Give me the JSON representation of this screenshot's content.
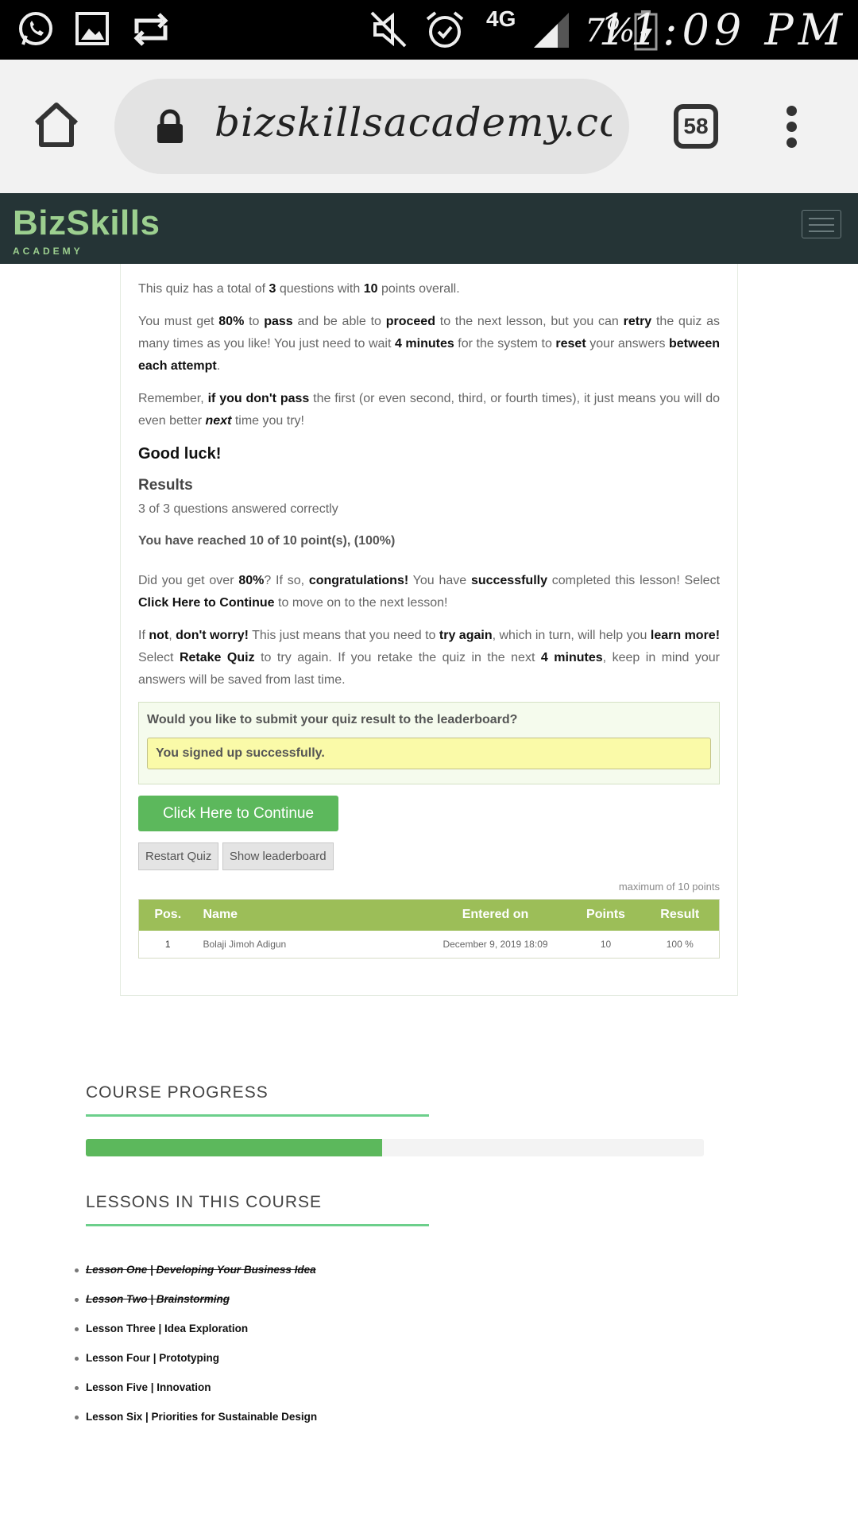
{
  "status_bar": {
    "time": "11:09 PM",
    "battery": "7%",
    "network": "4G",
    "icons": [
      "whatsapp-icon",
      "gallery-icon",
      "sync-icon",
      "mute-icon",
      "alarm-icon",
      "signal-icon",
      "battery-charging-icon"
    ]
  },
  "browser": {
    "url": "bizskillsacademy.com/c",
    "tab_count": "58"
  },
  "site": {
    "logo_main": "BizSkills",
    "logo_sub": "ACADEMY"
  },
  "quiz": {
    "intro": {
      "prefix": "This quiz has a total of ",
      "questions": "3",
      "mid": " questions with ",
      "points": "10",
      "suffix": " points overall."
    },
    "rules": {
      "t1": "You must get ",
      "b1": "80%",
      "t2": " to ",
      "b2": "pass",
      "t3": " and be able to ",
      "b3": "proceed",
      "t4": " to the next lesson, but you can ",
      "b4": "retry",
      "t5": " the quiz as many times as you like! You just need to wait ",
      "b5": "4 minutes",
      "t6": " for the system to ",
      "b6": "reset",
      "t7": " your answers ",
      "b7": "between each attempt",
      "t8": "."
    },
    "remember": {
      "t1": "Remember, ",
      "b1": "if you don't pass",
      "t2": " the first (or even second, third, or fourth times), it just means you will do even better ",
      "b2": "next",
      "t3": " time you try!"
    },
    "good_luck": "Good luck!",
    "results_heading": "Results",
    "results_summary": "3 of 3 questions answered correctly",
    "reached": "You have reached 10 of 10 point(s), (100%)",
    "over": {
      "t1": "Did you get over ",
      "b1": "80%",
      "t2": "? If so, ",
      "b2": "congratulations!",
      "t3": " You have ",
      "b3": "successfully",
      "t4": " completed this lesson! Select ",
      "b4": "Click Here to Continue",
      "t5": " to move on to the next lesson!"
    },
    "not": {
      "t1": "If ",
      "b1": "not",
      "t2": ", ",
      "b2": "don't worry!",
      "t3": " This just means that you need to ",
      "b3": "try again",
      "t4": ", which in turn, will help you ",
      "b4": "learn more!",
      "t5": " Select ",
      "b5": "Retake Quiz",
      "t6": " to try again. If you retake the quiz in the next ",
      "b6": "4 minutes",
      "t7": ", keep in mind your answers will be saved from last time."
    },
    "leaderboard_question": "Would you like to submit your quiz result to the leaderboard?",
    "signup_message": "You signed up successfully.",
    "continue_label": "Click Here to Continue",
    "restart_label": "Restart Quiz",
    "show_leaderboard_label": "Show leaderboard",
    "max_points": "maximum of 10 points",
    "table": {
      "headers": [
        "Pos.",
        "Name",
        "Entered on",
        "Points",
        "Result"
      ],
      "rows": [
        [
          "1",
          "Bolaji Jimoh Adigun",
          "December 9, 2019 18:09",
          "10",
          "100 %"
        ]
      ]
    }
  },
  "course_progress": {
    "heading": "COURSE PROGRESS",
    "percent": 48
  },
  "lessons": {
    "heading": "LESSONS IN THIS COURSE",
    "items": [
      {
        "label": "Lesson One | Developing Your Business Idea",
        "completed": true
      },
      {
        "label": "Lesson Two | Brainstorming",
        "completed": true
      },
      {
        "label": "Lesson Three | Idea Exploration",
        "completed": false
      },
      {
        "label": "Lesson Four | Prototyping",
        "completed": false
      },
      {
        "label": "Lesson Five | Innovation",
        "completed": false
      },
      {
        "label": "Lesson Six | Priorities for Sustainable Design",
        "completed": false
      }
    ]
  },
  "colors": {
    "accent_green": "#5cb85c",
    "table_header": "#9cbe58",
    "nav_bg": "#253436"
  }
}
